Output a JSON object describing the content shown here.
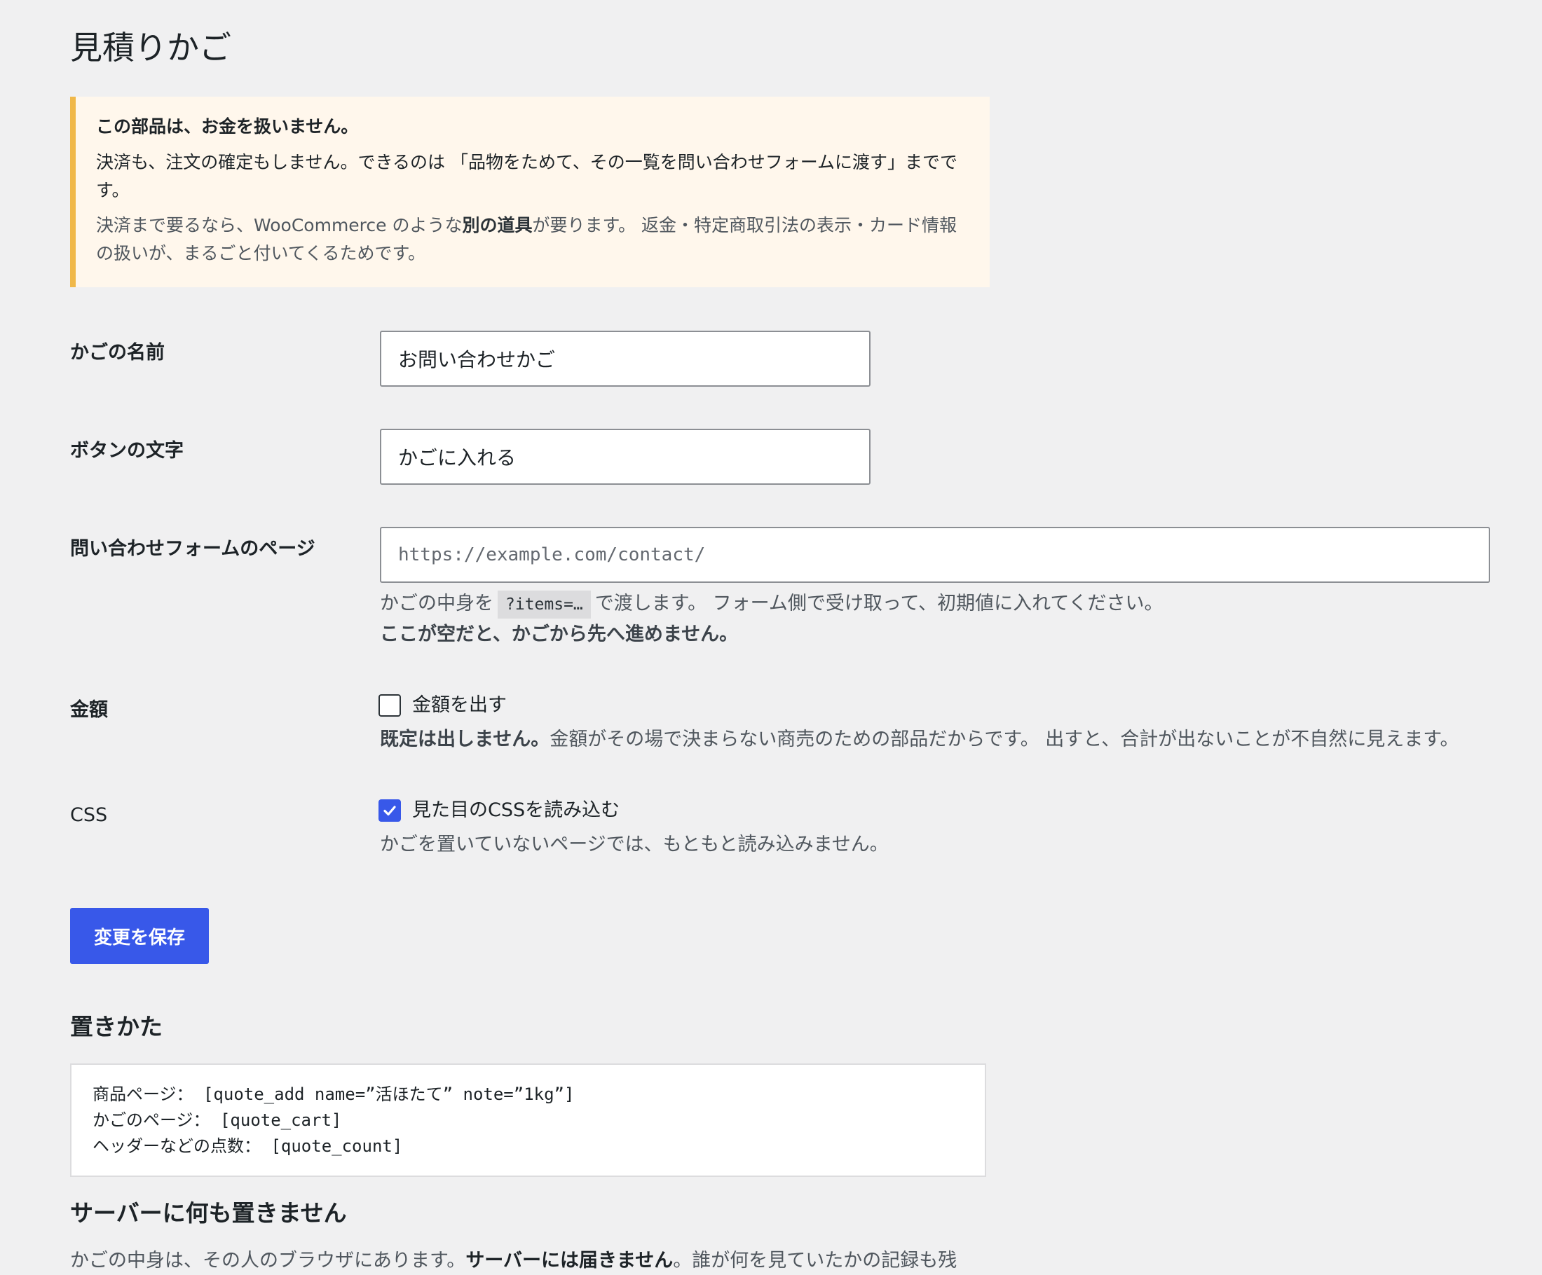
{
  "page": {
    "title": "見積りかご"
  },
  "notice": {
    "title": "この部品は、お金を扱いません。",
    "body": "決済も、注文の確定もしません。できるのは 「品物をためて、その一覧を問い合わせフォームに渡す」までです。",
    "note_before": "決済まで要るなら、WooCommerce のような",
    "note_strong": "別の道具",
    "note_after": "が要ります。 返金・特定商取引法の表示・カード情報の扱いが、まるごと付いてくるためです。",
    "accent_color": "#f0b849"
  },
  "fields": {
    "cart_name": {
      "label": "かごの名前",
      "value": "お問い合わせかご"
    },
    "button_text": {
      "label": "ボタンの文字",
      "value": "かごに入れる"
    },
    "form_page": {
      "label": "問い合わせフォームのページ",
      "value": "",
      "placeholder": "https://example.com/contact/",
      "desc_before": "かごの中身を",
      "desc_code": "?items=…",
      "desc_after": "で渡します。 フォーム側で受け取って、初期値に入れてください。",
      "desc_strong": "ここが空だと、かごから先へ進めません。"
    },
    "price": {
      "label": "金額",
      "checkbox_label": "金額を出す",
      "checked": false,
      "desc_strong": "既定は出しません。",
      "desc_rest": "金額がその場で決まらない商売のための部品だからです。 出すと、合計が出ないことが不自然に見えます。"
    },
    "css": {
      "label": "CSS",
      "checkbox_label": "見た目のCSSを読み込む",
      "checked": true,
      "desc": "かごを置いていないページでは、もともと読み込みません。"
    }
  },
  "save_button": {
    "label": "変更を保存",
    "color": "#3858e9"
  },
  "placement": {
    "heading": "置きかた",
    "lines": [
      "商品ページ： [quote_add name=”活ほたて” note=”1kg”]",
      "かごのページ： [quote_cart]",
      "ヘッダーなどの点数： [quote_count]"
    ]
  },
  "server": {
    "heading": "サーバーに何も置きません",
    "text_before": "かごの中身は、その人のブラウザにあります。",
    "text_strong": "サーバーには届きません",
    "text_after": "。誰が何を見ていたかの記録も残"
  }
}
